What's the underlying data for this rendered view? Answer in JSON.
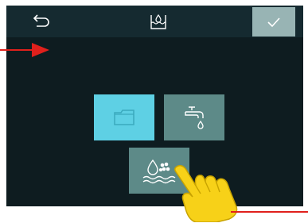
{
  "header": {
    "back_icon": "return-arrow-icon",
    "title_icon": "water-tank-level-icon",
    "confirm_icon": "check-icon"
  },
  "options": [
    {
      "name": "container",
      "icon": "container-icon",
      "selected": true
    },
    {
      "name": "tap-water",
      "icon": "faucet-drop-icon",
      "selected": false
    },
    {
      "name": "water-steam",
      "icon": "water-steam-icon",
      "selected": false
    }
  ],
  "annotations": {
    "pointer_arrow_color": "#e0201c",
    "hand_color": "#f7d118"
  },
  "colors": {
    "background": "#0e1c20",
    "topbar": "#152a30",
    "selected": "#5ed0e4",
    "unselected": "#5d8a88",
    "confirm": "#98b4b4"
  }
}
